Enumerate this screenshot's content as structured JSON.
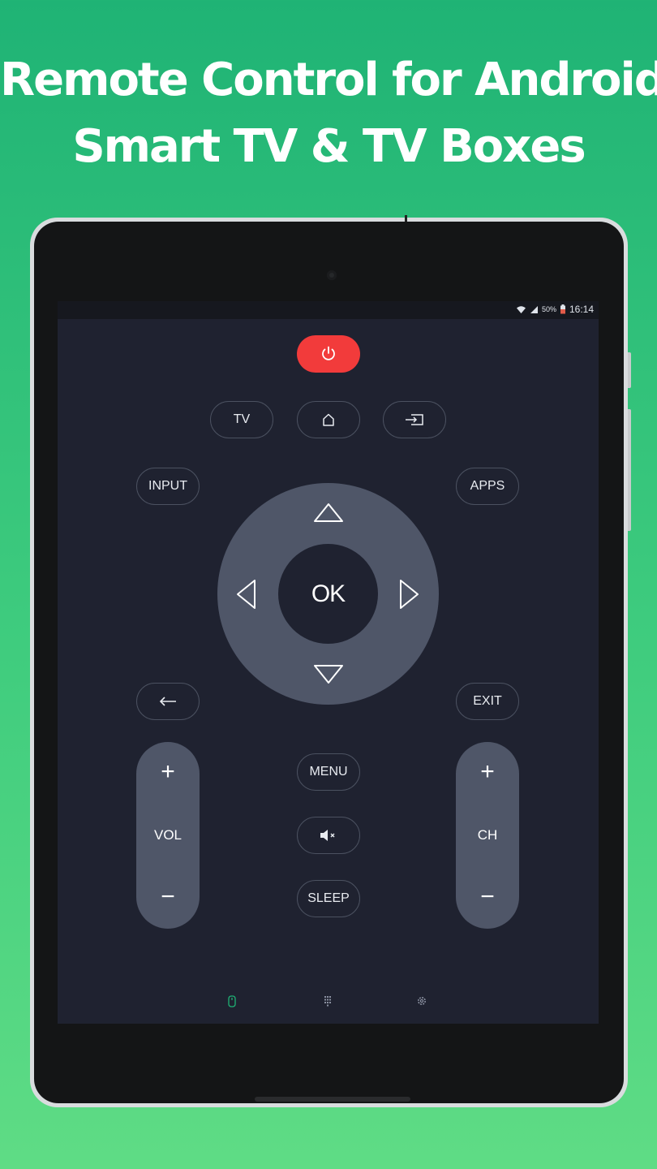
{
  "headline": {
    "line1": "Remote Control for Android",
    "line2": "Smart TV & TV Boxes"
  },
  "status_bar": {
    "battery": "50%",
    "time": "16:14"
  },
  "remote": {
    "tv_label": "TV",
    "input_label": "INPUT",
    "apps_label": "APPS",
    "ok_label": "OK",
    "exit_label": "EXIT",
    "menu_label": "MENU",
    "sleep_label": "SLEEP",
    "vol_label": "VOL",
    "ch_label": "CH",
    "plus": "+",
    "minus": "−"
  },
  "icons": {
    "power": "power-icon",
    "home": "home-icon",
    "source": "source-input-icon",
    "back": "arrow-left-icon",
    "mute": "mute-icon",
    "nav_remote": "remote-icon",
    "nav_keypad": "keypad-icon",
    "nav_settings": "gear-icon"
  },
  "colors": {
    "power": "#f23b3b",
    "screen_bg": "#1f2230",
    "control_bg": "#4f5668",
    "active_nav": "#1fb375"
  }
}
